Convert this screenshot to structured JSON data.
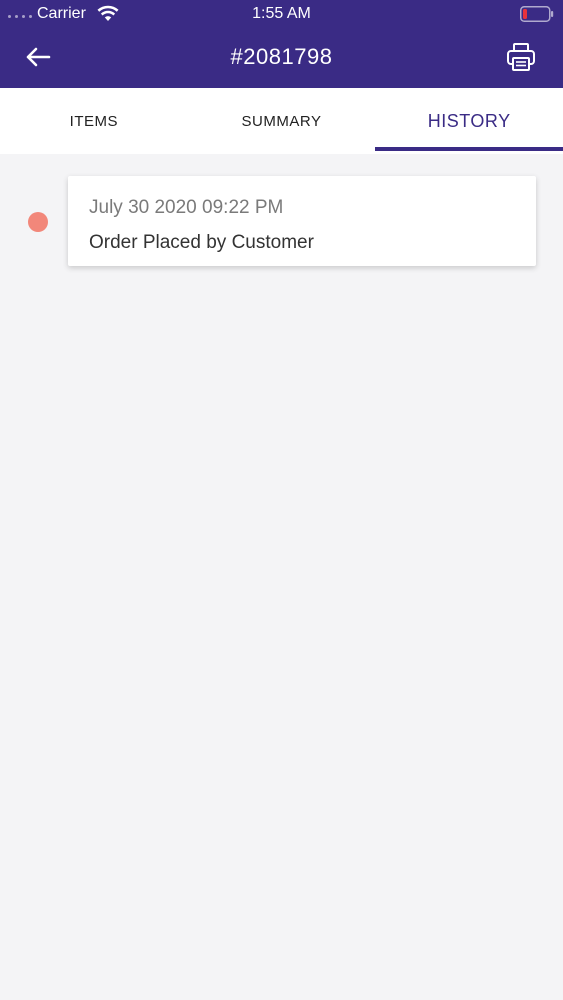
{
  "status_bar": {
    "carrier": "Carrier",
    "time": "1:55 AM",
    "icons": [
      "signal-dots",
      "wifi-icon",
      "battery-icon"
    ]
  },
  "header": {
    "title": "#2081798",
    "back_icon": "arrow-left-icon",
    "print_icon": "printer-icon"
  },
  "tabs": [
    {
      "label": "ITEMS",
      "active": false
    },
    {
      "label": "SUMMARY",
      "active": false
    },
    {
      "label": "HISTORY",
      "active": true
    }
  ],
  "history": [
    {
      "date": "July 30 2020 09:22 PM",
      "event": "Order Placed by Customer",
      "dot_color": "#f2877a"
    }
  ],
  "colors": {
    "primary": "#3a2b85",
    "background": "#f4f4f6",
    "timeline_dot": "#f2877a",
    "battery_low": "#e8323c"
  }
}
